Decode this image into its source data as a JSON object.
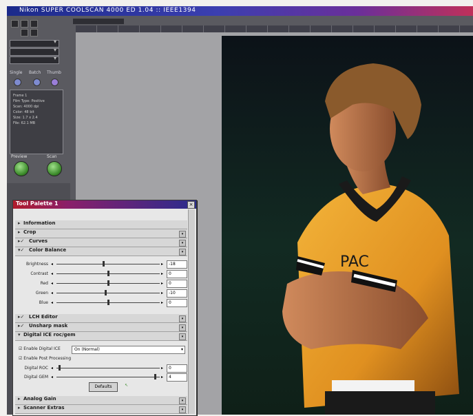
{
  "window": {
    "title": "Nikon SUPER COOLSCAN 4000 ED 1.04 :: IEEE1394"
  },
  "left_panel": {
    "modes": [
      "Single",
      "Batch",
      "Thumb"
    ],
    "info_text": "Frame 1\nFilm Type: Positive\nScan: 4000 dpi\nColor: 48 bit\nSize: 1.7 x 2.4\nFile: 62.1 MB",
    "preview_label": "Preview",
    "scan_label": "Scan"
  },
  "tool_palette": {
    "title": "Tool Palette 1",
    "sections": {
      "information": "Information",
      "crop": "Crop",
      "curves": "Curves",
      "color_balance": "Color Balance",
      "lch_editor": "LCH Editor",
      "unsharp_mask": "Unsharp mask",
      "digital_ice_roc_gem": "Digital ICE roc/gem",
      "analog_gain": "Analog Gain",
      "scanner_extras": "Scanner Extras"
    },
    "color_balance": [
      {
        "label": "Brightness",
        "value": "-18",
        "level": 0.45
      },
      {
        "label": "Contrast",
        "value": "0",
        "level": 0.5
      },
      {
        "label": "Red",
        "value": "0",
        "level": 0.5
      },
      {
        "label": "Green",
        "value": "-10",
        "level": 0.47
      },
      {
        "label": "Blue",
        "value": "0",
        "level": 0.5
      }
    ],
    "enable_digital_ice_label": "Enable Digital ICE",
    "ice_mode": "On (Normal)",
    "enable_post_processing_label": "Enable Post Processing",
    "ice_sliders": [
      {
        "label": "Digital ROC",
        "value": "0",
        "level": 0.02
      },
      {
        "label": "Digital GEM",
        "value": "4",
        "level": 0.96
      }
    ],
    "defaults_button": "Defaults"
  },
  "colors": {
    "title_bar_start": "#1b2a8a",
    "title_bar_end": "#c0305a",
    "palette_title": "#b01c2c",
    "shirt": "#e69a22"
  }
}
